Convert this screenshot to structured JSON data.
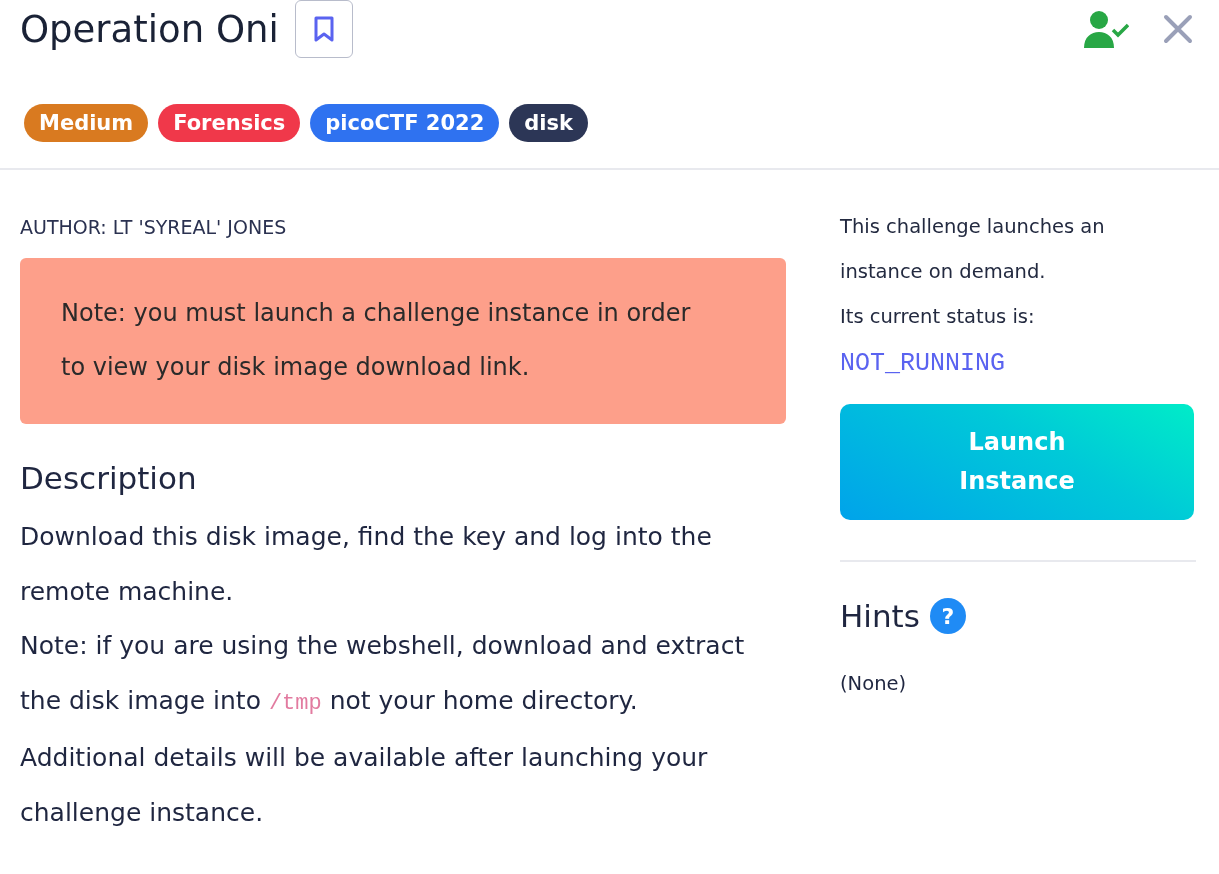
{
  "title": "Operation Oni",
  "tags": [
    {
      "label": "Medium",
      "color": "#d97a20"
    },
    {
      "label": "Forensics",
      "color": "#f0384a"
    },
    {
      "label": "picoCTF 2022",
      "color": "#2f72f0"
    },
    {
      "label": "disk",
      "color": "#2c3656"
    }
  ],
  "author": "AUTHOR: LT 'SYREAL' JONES",
  "note": "Note: you must launch a challenge instance in order to view your disk image download link.",
  "description": {
    "heading": "Description",
    "paragraphs": [
      [
        {
          "kind": "text",
          "text": "Download this disk image, find the key and log into the remote machine."
        }
      ],
      [
        {
          "kind": "text",
          "text": "Note: if you are using the webshell, download and extract the disk image into"
        },
        {
          "kind": "code",
          "text": "/tmp"
        },
        {
          "kind": "text",
          "text": "not your home directory."
        }
      ],
      [
        {
          "kind": "text",
          "text": "Additional details will be available after launching your challenge instance."
        }
      ]
    ]
  },
  "instance": {
    "lines": [
      "This challenge launches an instance on demand.",
      "Its current status is:"
    ],
    "status": "NOT_RUNNING",
    "button": "Launch Instance"
  },
  "hints": {
    "heading": "Hints",
    "help_icon": "?",
    "text": "(None)"
  }
}
